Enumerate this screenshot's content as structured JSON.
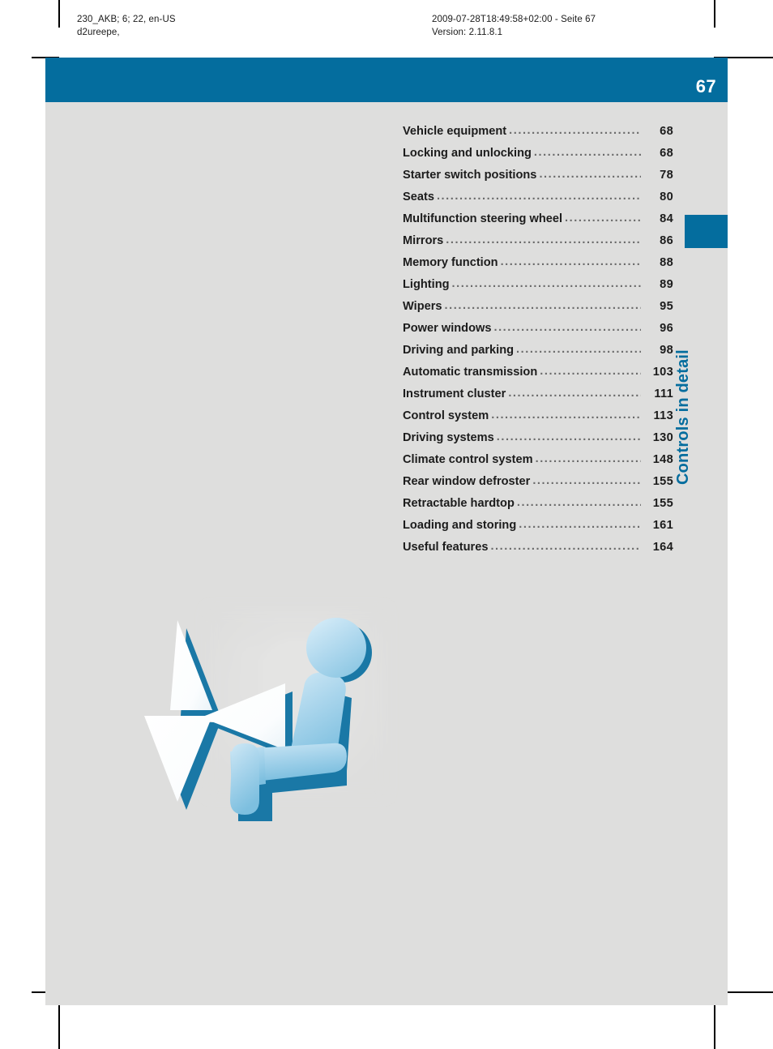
{
  "print_header": {
    "left": "230_AKB; 6; 22, en-US\nd2ureepe,",
    "right": "2009-07-28T18:49:58+02:00 - Seite 67\nVersion: 2.11.8.1"
  },
  "page": {
    "number": "67",
    "section_title": "Controls in detail",
    "accent_color": "#046d9e",
    "background_color": "#dededd"
  },
  "toc": {
    "dots": "...........................................................................",
    "entries": [
      {
        "label": "Vehicle equipment",
        "page": "68"
      },
      {
        "label": "Locking and unlocking",
        "page": "68"
      },
      {
        "label": "Starter switch positions",
        "page": "78"
      },
      {
        "label": "Seats",
        "page": "80"
      },
      {
        "label": "Multifunction steering wheel",
        "page": "84"
      },
      {
        "label": "Mirrors",
        "page": "86"
      },
      {
        "label": "Memory function",
        "page": "88"
      },
      {
        "label": "Lighting",
        "page": "89"
      },
      {
        "label": "Wipers",
        "page": "95"
      },
      {
        "label": "Power windows",
        "page": "96"
      },
      {
        "label": "Driving and parking",
        "page": "98"
      },
      {
        "label": "Automatic transmission",
        "page": "103"
      },
      {
        "label": "Instrument cluster",
        "page": "111"
      },
      {
        "label": "Control system",
        "page": "113"
      },
      {
        "label": "Driving systems",
        "page": "130"
      },
      {
        "label": "Climate control system",
        "page": "148"
      },
      {
        "label": "Rear window defroster",
        "page": "155"
      },
      {
        "label": "Retractable hardtop",
        "page": "155"
      },
      {
        "label": "Loading and storing",
        "page": "161"
      },
      {
        "label": "Useful features",
        "page": "164"
      }
    ]
  },
  "illustration": {
    "name": "seat-adjustment-pictogram",
    "figure_color": "#a6d4ea",
    "shadow_color": "#1a78a6",
    "arrow_color": "#ffffff"
  }
}
